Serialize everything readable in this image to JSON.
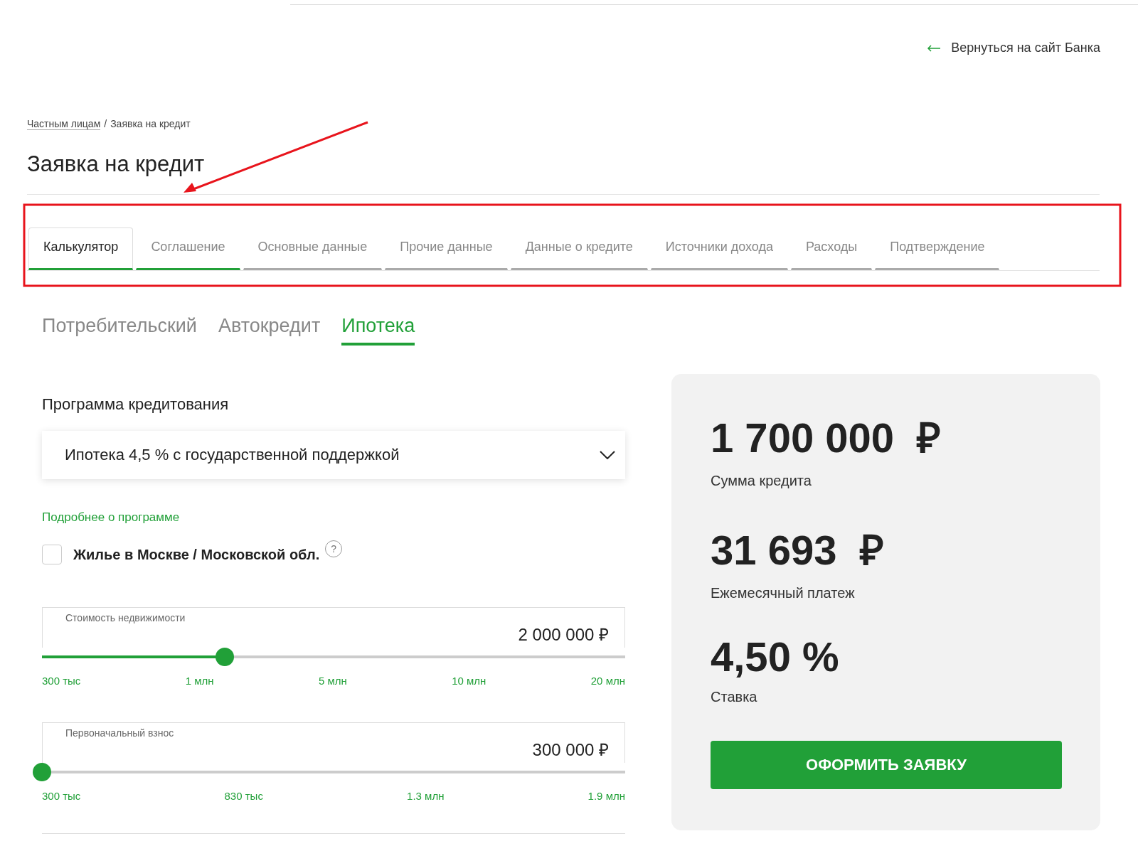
{
  "back_link": {
    "label": "Вернуться на сайт Банка"
  },
  "breadcrumb": [
    {
      "label": "Частным лицам"
    },
    {
      "label": "Заявка на кредит"
    }
  ],
  "breadcrumb_separator": "/",
  "title": "Заявка на кредит",
  "steps": [
    {
      "label": "Калькулятор",
      "selected": true,
      "done": true
    },
    {
      "label": "Соглашение",
      "selected": false,
      "done": true
    },
    {
      "label": "Основные данные",
      "selected": false,
      "done": false
    },
    {
      "label": "Прочие данные",
      "selected": false,
      "done": false
    },
    {
      "label": "Данные о кредите",
      "selected": false,
      "done": false
    },
    {
      "label": "Источники дохода",
      "selected": false,
      "done": false
    },
    {
      "label": "Расходы",
      "selected": false,
      "done": false
    },
    {
      "label": "Подтверждение",
      "selected": false,
      "done": false
    }
  ],
  "product_tabs": [
    {
      "label": "Потребительский",
      "selected": false
    },
    {
      "label": "Автокредит",
      "selected": false
    },
    {
      "label": "Ипотека",
      "selected": true
    }
  ],
  "program": {
    "label": "Программа кредитования",
    "value": "Ипотека 4,5 % с государственной поддержкой"
  },
  "more_link": "Подробнее о программе",
  "moscow_checkbox": {
    "label": "Жилье в Москве / Московской обл.",
    "checked": false,
    "help": "?"
  },
  "sliders": [
    {
      "label": "Стоимость недвижимости",
      "value": "2 000 000 ₽",
      "level": 0.314,
      "ticks": [
        "300 тыс",
        "1 млн",
        "5 млн",
        "10 млн",
        "20 млн"
      ]
    },
    {
      "label": "Первоначальный взнос",
      "value": "300 000 ₽",
      "level": 0,
      "ticks": [
        "300 тыс",
        "830 тыс",
        "1.3 млн",
        "1.9 млн"
      ]
    }
  ],
  "summary": [
    {
      "value": "1 700 000  ₽",
      "label": "Сумма кредита"
    },
    {
      "value": "31 693  ₽",
      "label": "Ежемесячный платеж"
    },
    {
      "value": "4,50 %",
      "label": "Ставка"
    }
  ],
  "submit_button": "ОФОРМИТЬ ЗАЯВКУ"
}
